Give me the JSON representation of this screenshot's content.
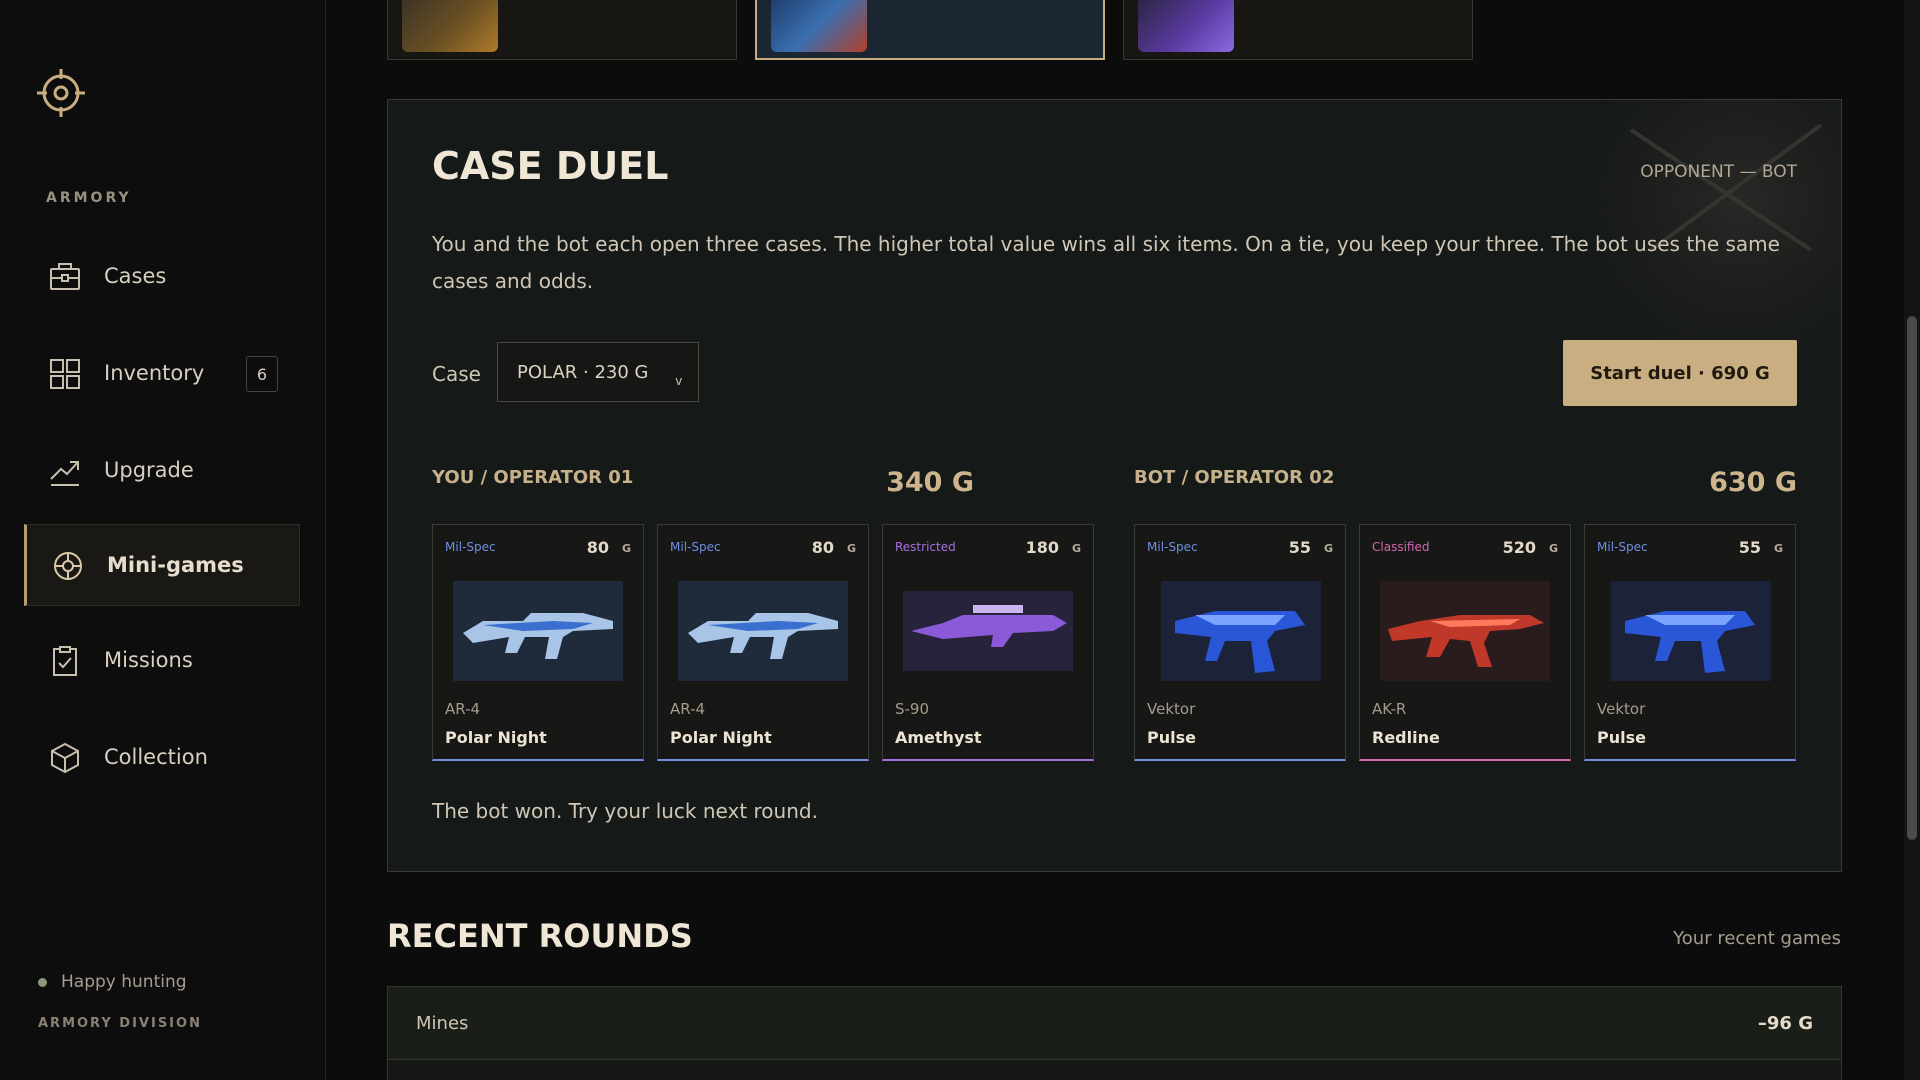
{
  "sidebar": {
    "section_label": "ARMORY",
    "items": [
      {
        "label": "Cases",
        "icon": "briefcase-icon"
      },
      {
        "label": "Inventory",
        "icon": "grid-icon",
        "badge": "6"
      },
      {
        "label": "Upgrade",
        "icon": "trend-up-icon"
      },
      {
        "label": "Mini-games",
        "icon": "target-icon",
        "active": true
      },
      {
        "label": "Missions",
        "icon": "clipboard-check-icon"
      },
      {
        "label": "Collection",
        "icon": "box-icon"
      }
    ],
    "footer": {
      "status": "Happy hunting",
      "division": "ARMORY DIVISION"
    }
  },
  "duel": {
    "title": "CASE DUEL",
    "opponent": "OPPONENT — BOT",
    "description": "You and the bot each open three cases. The higher total value wins all six items. On a tie, you keep your three. The bot uses the same cases and odds.",
    "case_label": "Case",
    "case_value": "POLAR · 230 G",
    "start_button": "Start duel · 690 G",
    "you": {
      "title": "YOU / OPERATOR 01",
      "total": "340 G",
      "items": [
        {
          "rarity": "Mil-Spec",
          "value": "80",
          "unit": "G",
          "model": "AR-4",
          "name": "Polar Night"
        },
        {
          "rarity": "Mil-Spec",
          "value": "80",
          "unit": "G",
          "model": "AR-4",
          "name": "Polar Night"
        },
        {
          "rarity": "Restricted",
          "value": "180",
          "unit": "G",
          "model": "S-90",
          "name": "Amethyst"
        }
      ]
    },
    "bot": {
      "title": "BOT / OPERATOR 02",
      "total": "630 G",
      "items": [
        {
          "rarity": "Mil-Spec",
          "value": "55",
          "unit": "G",
          "model": "Vektor",
          "name": "Pulse"
        },
        {
          "rarity": "Classified",
          "value": "520",
          "unit": "G",
          "model": "AK-R",
          "name": "Redline"
        },
        {
          "rarity": "Mil-Spec",
          "value": "55",
          "unit": "G",
          "model": "Vektor",
          "name": "Pulse"
        }
      ]
    },
    "result": "The bot won. Try your luck next round."
  },
  "recent": {
    "title": "RECENT ROUNDS",
    "subtitle": "Your recent games",
    "rows": [
      {
        "name": "Mines",
        "delta": "–96 G"
      }
    ]
  },
  "colors": {
    "accent": "#c9ae82",
    "mil_spec": "#6f8fe6",
    "restricted": "#a66fe0",
    "classified": "#d567b3"
  }
}
